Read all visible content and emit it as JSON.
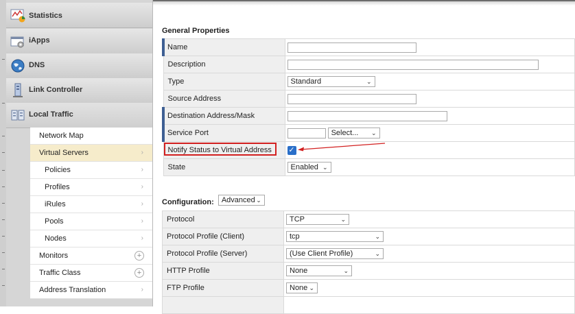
{
  "sidebar": {
    "modules": [
      {
        "title": "Statistics",
        "icon": "statistics-icon"
      },
      {
        "title": "iApps",
        "icon": "iapps-icon"
      },
      {
        "title": "DNS",
        "icon": "dns-globe-icon"
      },
      {
        "title": "Link Controller",
        "icon": "link-controller-icon"
      },
      {
        "title": "Local Traffic",
        "icon": "local-traffic-icon"
      }
    ],
    "local_traffic_items": [
      {
        "label": "Network Map"
      },
      {
        "label": "Virtual Servers",
        "selected": true
      },
      {
        "label": "Policies",
        "indent": true
      },
      {
        "label": "Profiles",
        "indent": true
      },
      {
        "label": "iRules",
        "indent": true
      },
      {
        "label": "Pools",
        "indent": true
      },
      {
        "label": "Nodes",
        "indent": true
      },
      {
        "label": "Monitors"
      },
      {
        "label": "Traffic Class"
      },
      {
        "label": "Address Translation"
      }
    ],
    "arrow_glyph": "›",
    "plus_glyph": "+"
  },
  "general": {
    "title": "General Properties",
    "name_label": "Name",
    "name_value": "",
    "description_label": "Description",
    "description_value": "",
    "type_label": "Type",
    "type_value": "Standard",
    "source_label": "Source Address",
    "source_value": "",
    "destination_label": "Destination Address/Mask",
    "destination_value": "",
    "service_port_label": "Service Port",
    "service_port_value": "",
    "service_port_select": "Select...",
    "notify_label": "Notify Status to Virtual Address",
    "notify_checked": true,
    "state_label": "State",
    "state_value": "Enabled"
  },
  "configuration": {
    "title": "Configuration:",
    "mode_value": "Advanced",
    "protocol_label": "Protocol",
    "protocol_value": "TCP",
    "client_profile_label": "Protocol Profile (Client)",
    "client_profile_value": "tcp",
    "server_profile_label": "Protocol Profile (Server)",
    "server_profile_value": "(Use Client Profile)",
    "http_profile_label": "HTTP Profile",
    "http_profile_value": "None",
    "ftp_profile_label": "FTP Profile",
    "ftp_profile_value": "None"
  },
  "icons": {
    "chevron": "⌄",
    "check": "✓"
  },
  "colors": {
    "required_bar": "#3e5f93",
    "annotation_red": "#d21f1f",
    "selected_nav": "#f6eccb",
    "checkbox_blue": "#2a6fc9"
  }
}
